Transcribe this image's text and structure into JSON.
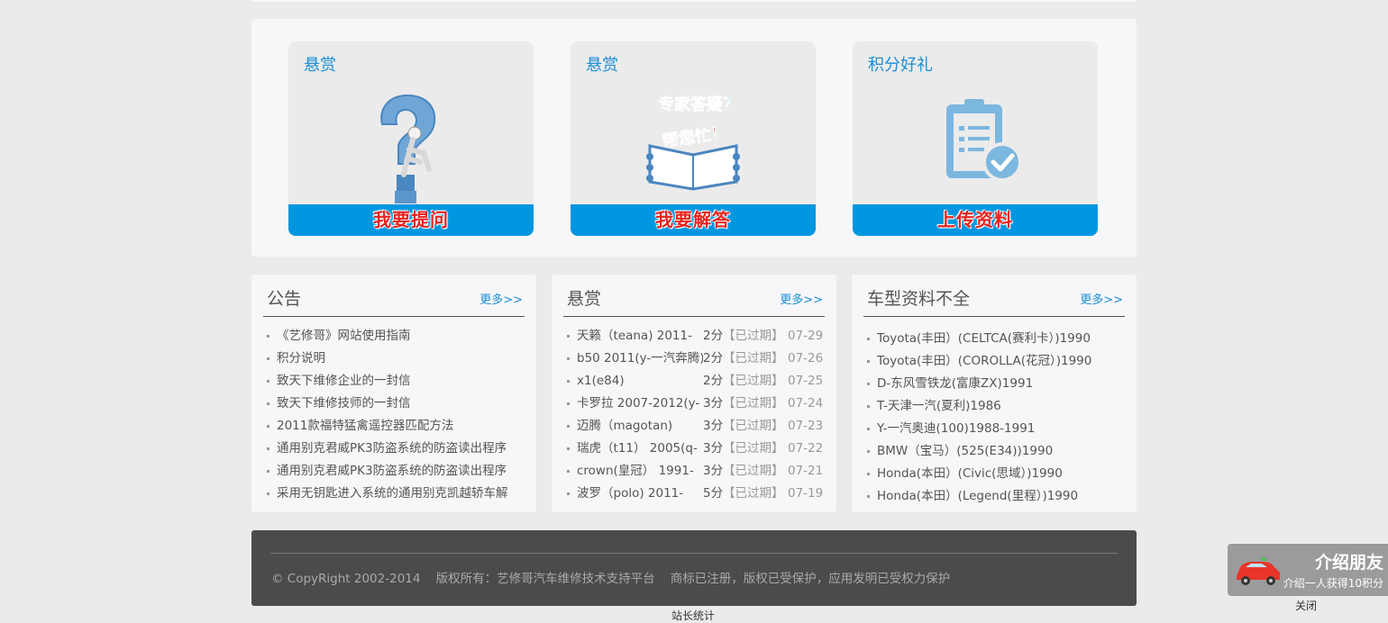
{
  "cards": [
    {
      "title": "悬赏",
      "button": "我要提问",
      "icon": "question-mark-figure-icon"
    },
    {
      "title": "悬赏",
      "art_line1": "专家答疑？",
      "art_line2": "帮您忙！",
      "button": "我要解答",
      "icon": "book-help-icon"
    },
    {
      "title": "积分好礼",
      "button": "上传资料",
      "icon": "clipboard-check-icon"
    }
  ],
  "notice": {
    "title": "公告",
    "more": "更多>>",
    "items": [
      "《艺修哥》网站使用指南",
      "积分说明",
      "致天下维修企业的一封信",
      "致天下维修技师的一封信",
      "2011款福特猛禽遥控器匹配方法",
      "通用别克君威PK3防盗系统的防盗读出程序",
      "通用别克君威PK3防盗系统的防盗读出程序",
      "采用无钥匙进入系统的通用别克凯越轿车解"
    ]
  },
  "reward": {
    "title": "悬赏",
    "more": "更多>>",
    "items": [
      {
        "name": "天籁（teana) 2011-",
        "points": "2分",
        "status": "【已过期】",
        "date": "07-29"
      },
      {
        "name": "b50 2011(y-一汽奔腾)",
        "points": "2分",
        "status": "【已过期】",
        "date": "07-26"
      },
      {
        "name": "x1(e84)",
        "points": "2分",
        "status": "【已过期】",
        "date": "07-25"
      },
      {
        "name": "卡罗拉 2007-2012(y-",
        "points": "3分",
        "status": "【已过期】",
        "date": "07-24"
      },
      {
        "name": "迈腾（magotan)",
        "points": "3分",
        "status": "【已过期】",
        "date": "07-23"
      },
      {
        "name": "瑞虎（t11） 2005(q-",
        "points": "3分",
        "status": "【已过期】",
        "date": "07-22"
      },
      {
        "name": "crown(皇冠） 1991-",
        "points": "3分",
        "status": "【已过期】",
        "date": "07-21"
      },
      {
        "name": "波罗（polo) 2011-",
        "points": "5分",
        "status": "【已过期】",
        "date": "07-19"
      }
    ]
  },
  "models": {
    "title": "车型资料不全",
    "more": "更多>>",
    "items": [
      "Toyota(丰田）(CELTCA(赛利卡）)1990",
      "Toyota(丰田）(COROLLA(花冠）)1990",
      "D-东风雪铁龙(富康ZX)1991",
      "T-天津一汽(夏利)1986",
      "Y-一汽奥迪(100)1988-1991",
      "BMW（宝马）(525(E34))1990",
      "Honda(本田）(Civic(思域）)1990",
      "Honda(本田）(Legend(里程）)1990"
    ]
  },
  "footer": {
    "text": "© CopyRight 2002-2014    版权所有：艺修哥汽车维修技术支持平台    商标已注册，版权已受保护，应用发明已受权力保护"
  },
  "stat_link": "站长统计",
  "invite": {
    "title": "介绍朋友",
    "subtitle": "介绍一人获得10积分",
    "close": "关闭"
  },
  "colors": {
    "accent": "#0096e0",
    "title_blue": "#1a8ed6",
    "button_text": "#e8221e",
    "footer_bg": "#4b4b4b"
  }
}
